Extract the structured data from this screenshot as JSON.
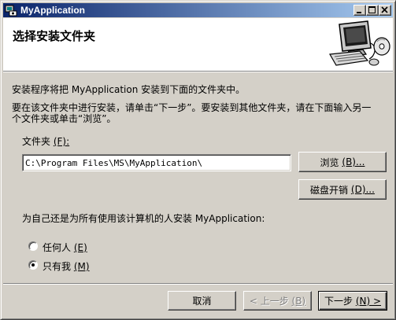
{
  "window": {
    "title": "MyApplication",
    "icon": "installer-icon"
  },
  "banner": {
    "title": "选择安装文件夹",
    "art": "computer-with-disc-icon"
  },
  "content": {
    "line1": "安装程序将把 MyApplication 安装到下面的文件夹中。",
    "line2": "要在该文件夹中进行安装，请单击“下一步”。要安装到其他文件夹，请在下面输入另一",
    "line3": "个文件夹或单击“浏览”。",
    "folder_label": "文件夹",
    "folder_key": "(F):",
    "folder_value": "C:\\Program Files\\MS\\MyApplication\\",
    "browse_label": "浏览",
    "browse_key": "(B)...",
    "disk_cost_label": "磁盘开销",
    "disk_cost_key": "(D)...",
    "install_for_label": "为自己还是为所有使用该计算机的人安装 MyApplication:",
    "radio_everyone_label": "任何人",
    "radio_everyone_key": "(E)",
    "radio_justme_label": "只有我",
    "radio_justme_key": "(M)",
    "selected_option": "just_me"
  },
  "footer": {
    "cancel_label": "取消",
    "back_label": "< 上一步",
    "back_key": "(B)",
    "next_label": "下一步",
    "next_key": "(N) >"
  },
  "colors": {
    "title_bar_start": "#0a246a",
    "title_bar_end": "#a6caf0",
    "face": "#d4d0c8"
  }
}
